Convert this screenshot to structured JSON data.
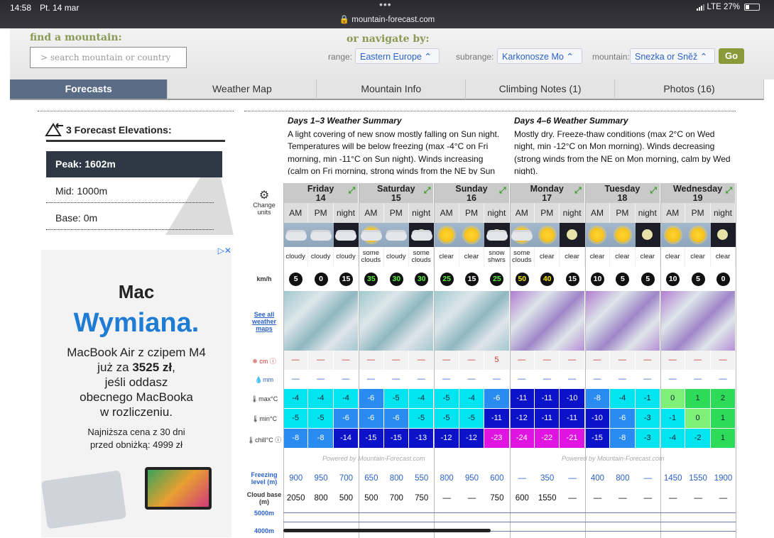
{
  "status": {
    "time": "14:58",
    "date": "Pt. 14 mar",
    "url": "mountain-forecast.com",
    "network": "LTE 27%"
  },
  "header": {
    "find_label": "find a mountain:",
    "search_placeholder": "> search mountain or country",
    "nav_label": "or navigate by:",
    "range_label": "range:",
    "range_value": "Eastern Europe",
    "subrange_label": "subrange:",
    "subrange_value": "Karkonosze Mo",
    "mountain_label": "mountain:",
    "mountain_value": "Snezka or Sněž",
    "go": "Go"
  },
  "tabs": [
    "Forecasts",
    "Weather Map",
    "Mountain Info",
    "Climbing Notes (1)",
    "Photos (16)"
  ],
  "elevations": {
    "title": "3 Forecast Elevations:",
    "peak": "Peak: 1602m",
    "mid": "Mid: 1000m",
    "base": "Base: 0m"
  },
  "ad": {
    "brand": "Mac",
    "headline": "Wymiana.",
    "body1": "MacBook Air z czipem M4",
    "body2": "już za",
    "price": "3525 zł",
    "body3": "jeśli oddasz",
    "body4": "obecnego MacBooka",
    "body5": "w rozliczeniu.",
    "small1": "Najniższa cena z 30 dni",
    "small2": "przed obniżką: 4999 zł"
  },
  "summary": {
    "d13_title": "Days 1–3 Weather Summary",
    "d13_text": "A light covering of new snow mostly falling on Sun night. Temperatures will be below freezing (max -4°C on Fri morning, min -11°C on Sun night). Winds increasing (calm on Fri morning, strong winds from the NE by Sun night).",
    "d46_title": "Days 4–6 Weather Summary",
    "d46_text": "Mostly dry. Freeze-thaw conditions (max 2°C on Wed night, min -12°C on Mon morning). Winds decreasing (strong winds from the NE on Mon morning, calm by Wed night)."
  },
  "labels": {
    "change_units": "Change units",
    "kmh": "km/h",
    "see_all": "See all weather maps",
    "snow": "cm",
    "rain": "mm",
    "max": "max°C",
    "min": "min°C",
    "chill": "chill°C",
    "freezing": "Freezing level (m)",
    "cloudbase": "Cloud base (m)",
    "a5000": "5000m",
    "a4000": "4000m",
    "powered": "Powered by Mountain-Forecast.com"
  },
  "days": [
    {
      "name": "Friday",
      "num": "14"
    },
    {
      "name": "Saturday",
      "num": "15"
    },
    {
      "name": "Sunday",
      "num": "16"
    },
    {
      "name": "Monday",
      "num": "17"
    },
    {
      "name": "Tuesday",
      "num": "18"
    },
    {
      "name": "Wednesday",
      "num": "19"
    }
  ],
  "periods": [
    "AM",
    "PM",
    "night",
    "AM",
    "PM",
    "night",
    "AM",
    "PM",
    "night",
    "AM",
    "PM",
    "night",
    "AM",
    "PM",
    "night",
    "AM",
    "PM",
    "night"
  ],
  "desc": [
    "cloudy",
    "cloudy",
    "cloudy",
    "some clouds",
    "cloudy",
    "some clouds",
    "clear",
    "clear",
    "snow shwrs",
    "some clouds",
    "clear",
    "clear",
    "clear",
    "clear",
    "clear",
    "clear",
    "clear",
    "clear"
  ],
  "wind": [
    "5",
    "0",
    "15",
    "35",
    "30",
    "30",
    "25",
    "15",
    "25",
    "50",
    "40",
    "15",
    "10",
    "5",
    "5",
    "10",
    "5",
    "0"
  ],
  "snow": [
    "—",
    "—",
    "—",
    "—",
    "—",
    "—",
    "—",
    "—",
    "5",
    "—",
    "—",
    "—",
    "—",
    "—",
    "—",
    "—",
    "—",
    "—"
  ],
  "rain": [
    "—",
    "—",
    "—",
    "—",
    "—",
    "—",
    "—",
    "—",
    "—",
    "—",
    "—",
    "—",
    "—",
    "—",
    "—",
    "—",
    "—",
    "—"
  ],
  "max": [
    "-4",
    "-4",
    "-4",
    "-6",
    "-5",
    "-4",
    "-5",
    "-4",
    "-6",
    "-11",
    "-11",
    "-10",
    "-8",
    "-4",
    "-1",
    "0",
    "1",
    "2"
  ],
  "min": [
    "-5",
    "-5",
    "-6",
    "-6",
    "-6",
    "-5",
    "-5",
    "-5",
    "-11",
    "-12",
    "-11",
    "-11",
    "-10",
    "-6",
    "-3",
    "-1",
    "0",
    "1"
  ],
  "chill": [
    "-8",
    "-8",
    "-14",
    "-15",
    "-15",
    "-13",
    "-12",
    "-12",
    "-23",
    "-24",
    "-22",
    "-21",
    "-15",
    "-8",
    "-3",
    "-4",
    "-2",
    "1"
  ],
  "freezing": [
    "900",
    "950",
    "700",
    "650",
    "800",
    "550",
    "800",
    "950",
    "600",
    "—",
    "350",
    "—",
    "400",
    "800",
    "—",
    "1450",
    "1550",
    "1900"
  ],
  "cloudbase": [
    "2050",
    "800",
    "500",
    "500",
    "700",
    "750",
    "—",
    "—",
    "750",
    "600",
    "1550",
    "—",
    "—",
    "—",
    "—",
    "—",
    "—",
    "—"
  ],
  "colors": {
    "cyan": "#00e5f0",
    "blue": "#2a8cf0",
    "dblue": "#1c3ee0",
    "navy": "#0c12c8",
    "magenta": "#e014e0",
    "green": "#2edb59",
    "lgreen": "#7ef07a"
  }
}
